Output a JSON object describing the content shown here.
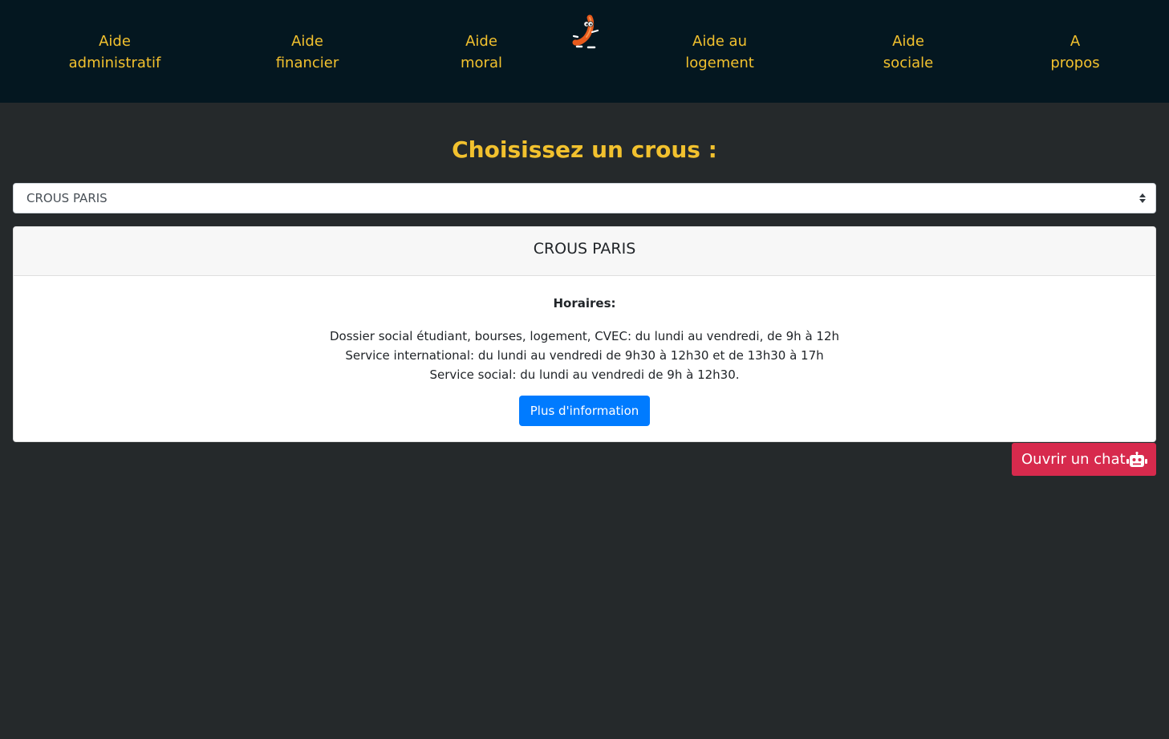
{
  "nav": {
    "items": [
      {
        "line1": "Aide",
        "line2": "administratif"
      },
      {
        "line1": "Aide",
        "line2": "financier"
      },
      {
        "line1": "Aide",
        "line2": "moral"
      },
      {
        "line1": "Aide au",
        "line2": "logement"
      },
      {
        "line1": "Aide",
        "line2": "sociale"
      },
      {
        "line1": "A",
        "line2": "propos"
      }
    ],
    "logo_icon": "mascot-logo-icon"
  },
  "main": {
    "title": "Choisissez un crous :",
    "select": {
      "selected": "CROUS PARIS"
    },
    "card": {
      "header": "CROUS PARIS",
      "hours_label": "Horaires:",
      "hours": [
        "Dossier social étudiant, bourses, logement, CVEC: du lundi au vendredi, de 9h à 12h",
        "Service international: du lundi au vendredi de 9h30 à 12h30 et de 13h30 à 17h",
        "Service social: du lundi au vendredi de 9h à 12h30."
      ],
      "button_label": "Plus d'information"
    }
  },
  "chat": {
    "label": "Ouvrir un chat",
    "icon": "robot-icon"
  },
  "colors": {
    "accent": "#f2c12e",
    "navbar": "#041720",
    "background": "#25292b",
    "primary_button": "#007bff",
    "chat_button": "#d72a4d"
  }
}
